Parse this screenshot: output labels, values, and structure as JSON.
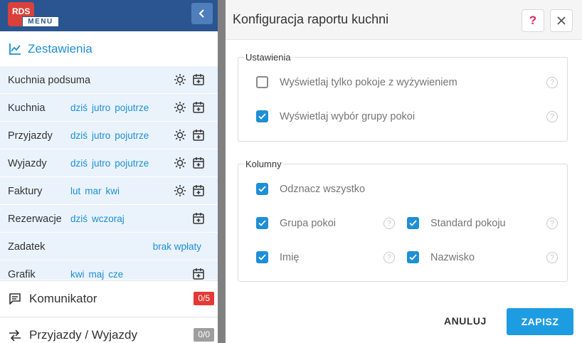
{
  "sidebar": {
    "logo": {
      "text": "RDS",
      "menu_label": "MENU"
    },
    "collapse_icon": "chevron-left-icon",
    "section_title": "Zestawienia",
    "section_icon": "chart-icon",
    "reports": [
      {
        "name": "Kuchnia podsuma",
        "links": [],
        "gear": true,
        "calendar": true
      },
      {
        "name": "Kuchnia",
        "links": [
          "dziś",
          "jutro",
          "pojutrze"
        ],
        "gear": true,
        "calendar": true
      },
      {
        "name": "Przyjazdy",
        "links": [
          "dziś",
          "jutro",
          "pojutrze"
        ],
        "gear": true,
        "calendar": true
      },
      {
        "name": "Wyjazdy",
        "links": [
          "dziś",
          "jutro",
          "pojutrze"
        ],
        "gear": true,
        "calendar": true
      },
      {
        "name": "Faktury",
        "links": [
          "lut",
          "mar",
          "kwi"
        ],
        "gear": true,
        "calendar": true
      },
      {
        "name": "Rezerwacje",
        "links": [
          "dziś",
          "wczoraj"
        ],
        "gear": false,
        "calendar": true
      },
      {
        "name": "Zadatek",
        "links": [
          "brak wpłaty"
        ],
        "gear": false,
        "calendar": false
      },
      {
        "name": "Grafik",
        "links": [
          "kwi",
          "maj",
          "cze"
        ],
        "gear": false,
        "calendar": true
      }
    ],
    "nav": {
      "komunikator": {
        "label": "Komunikator",
        "badge": "0/5",
        "badge_color": "#e53935",
        "icon": "message-icon"
      },
      "przyjazdy": {
        "label": "Przyjazdy / Wyjazdy",
        "badge": "0/0",
        "badge_color": "#9e9e9e",
        "icon": "arrows-icon"
      }
    }
  },
  "modal": {
    "title": "Konfiguracja raportu kuchni",
    "help_label": "?",
    "settings": {
      "legend": "Ustawienia",
      "options": [
        {
          "label": "Wyświetlaj tylko pokoje z wyżywieniem",
          "checked": false
        },
        {
          "label": "Wyświetlaj wybór grupy pokoi",
          "checked": true
        }
      ]
    },
    "columns": {
      "legend": "Kolumny",
      "select_all": {
        "label": "Odznacz wszystko",
        "checked": true
      },
      "items": [
        {
          "label": "Grupa pokoi",
          "checked": true
        },
        {
          "label": "Standard pokoju",
          "checked": true
        },
        {
          "label": "Imię",
          "checked": true
        },
        {
          "label": "Nazwisko",
          "checked": true
        }
      ]
    },
    "cancel_label": "ANULUJ",
    "save_label": "ZAPISZ"
  },
  "colors": {
    "accent": "#1d8fd6",
    "header": "#2a5590",
    "logo": "#d9413c"
  }
}
